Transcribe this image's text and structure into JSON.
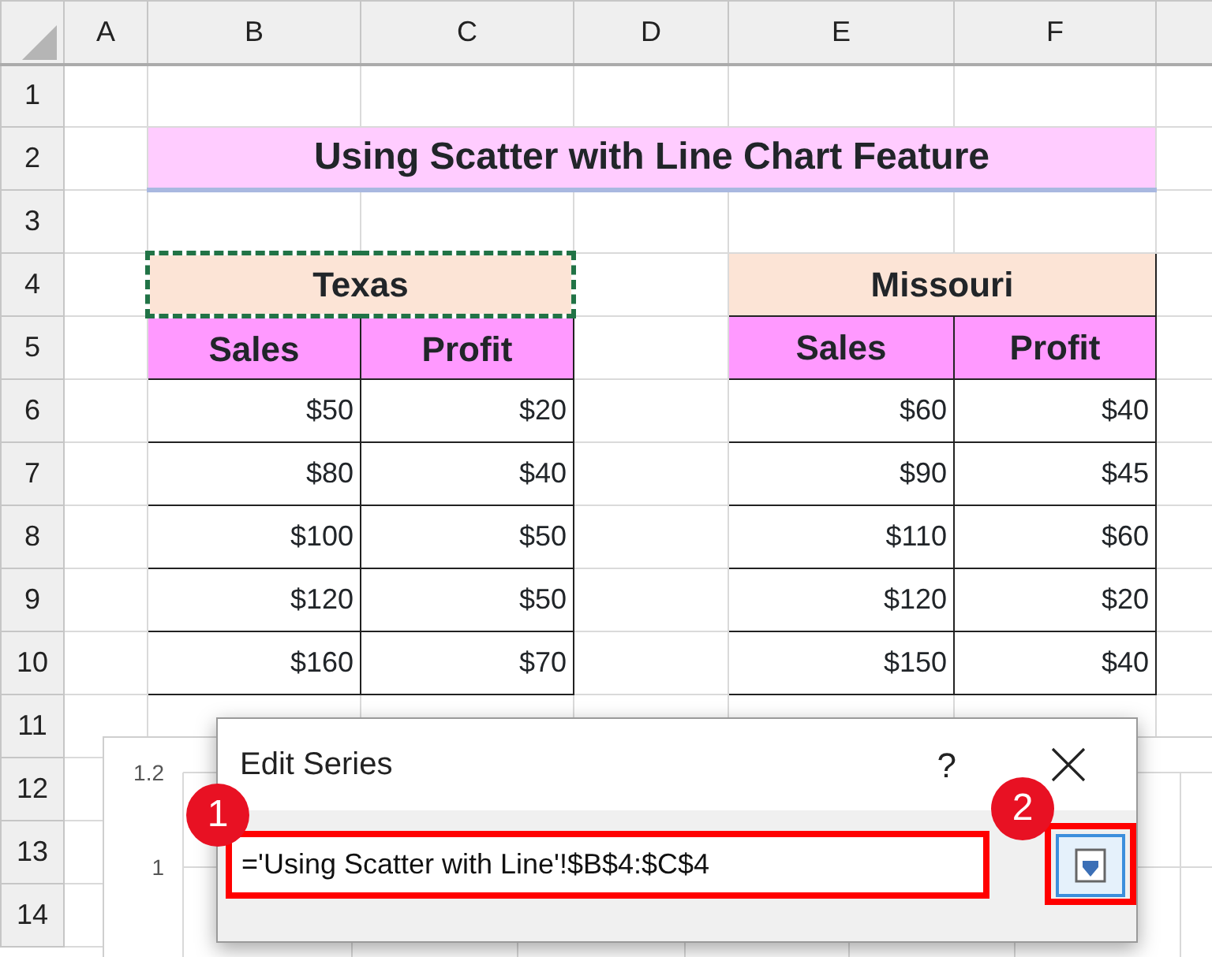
{
  "column_headers": [
    "A",
    "B",
    "C",
    "D",
    "E",
    "F"
  ],
  "row_headers": [
    "1",
    "2",
    "3",
    "4",
    "5",
    "6",
    "7",
    "8",
    "9",
    "10",
    "11",
    "12",
    "13",
    "14"
  ],
  "title": "Using Scatter with Line Chart Feature",
  "tables": [
    {
      "name": "Texas",
      "copied": true,
      "headers": [
        "Sales",
        "Profit"
      ],
      "rows": [
        [
          "$50",
          "$20"
        ],
        [
          "$80",
          "$40"
        ],
        [
          "$100",
          "$50"
        ],
        [
          "$120",
          "$50"
        ],
        [
          "$160",
          "$70"
        ]
      ]
    },
    {
      "name": "Missouri",
      "copied": false,
      "headers": [
        "Sales",
        "Profit"
      ],
      "rows": [
        [
          "$60",
          "$40"
        ],
        [
          "$90",
          "$45"
        ],
        [
          "$110",
          "$60"
        ],
        [
          "$120",
          "$20"
        ],
        [
          "$150",
          "$40"
        ]
      ]
    }
  ],
  "chart": {
    "y_labels": [
      "1.2",
      "1"
    ]
  },
  "dialog": {
    "title": "Edit Series",
    "help": "?",
    "value": "='Using Scatter with Line'!$B$4:$C$4",
    "callouts": [
      "1",
      "2"
    ]
  }
}
